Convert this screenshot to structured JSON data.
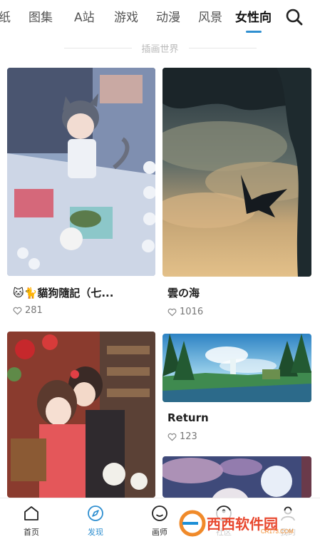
{
  "tabs": [
    {
      "label": "纸"
    },
    {
      "label": "图集"
    },
    {
      "label": "A站"
    },
    {
      "label": "游戏"
    },
    {
      "label": "动漫"
    },
    {
      "label": "风景"
    },
    {
      "label": "女性向",
      "active": true
    }
  ],
  "section_label": "插画世界",
  "cards": [
    {
      "title": "🐱🐈貓狗隨記（七...",
      "likes": "281"
    },
    {
      "title": "雲の海",
      "likes": "1016"
    },
    {
      "title": "",
      "likes": ""
    },
    {
      "title": "Return",
      "likes": "123"
    }
  ],
  "bottom_nav": [
    {
      "label": "首页",
      "icon": "home-icon"
    },
    {
      "label": "发现",
      "icon": "compass-icon",
      "active": true
    },
    {
      "label": "画师",
      "icon": "smile-icon"
    },
    {
      "label": "社区",
      "icon": "community-icon"
    },
    {
      "label": "我的",
      "icon": "person-icon"
    }
  ],
  "watermark": {
    "brand": "西西软件园",
    "url": "CR173.COM"
  },
  "colors": {
    "accent": "#2f8fd0",
    "text": "#1f1f1f",
    "muted": "#777777"
  }
}
